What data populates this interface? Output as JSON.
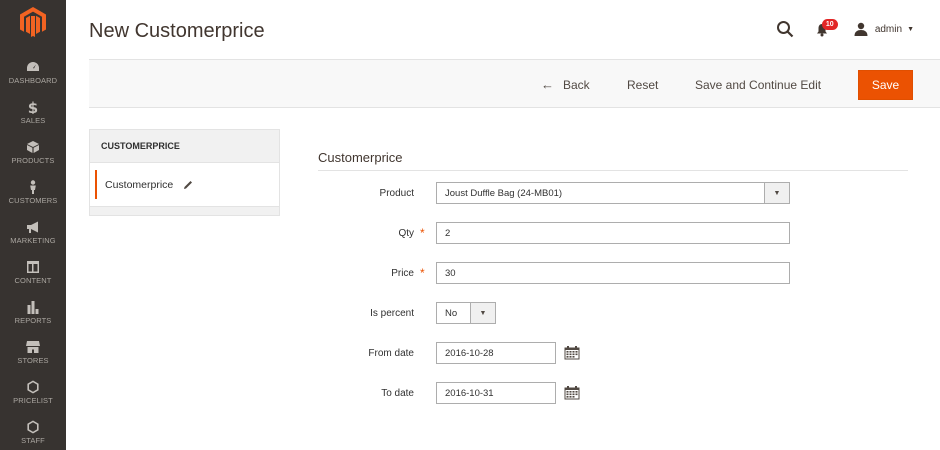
{
  "nav": {
    "items": [
      {
        "label": "DASHBOARD",
        "icon": "dashboard-icon"
      },
      {
        "label": "SALES",
        "icon": "dollar-icon"
      },
      {
        "label": "PRODUCTS",
        "icon": "cube-icon"
      },
      {
        "label": "CUSTOMERS",
        "icon": "person-icon"
      },
      {
        "label": "MARKETING",
        "icon": "megaphone-icon"
      },
      {
        "label": "CONTENT",
        "icon": "layout-icon"
      },
      {
        "label": "REPORTS",
        "icon": "bar-chart-icon"
      },
      {
        "label": "STORES",
        "icon": "storefront-icon"
      },
      {
        "label": "PRICELIST",
        "icon": "hexagon-icon"
      },
      {
        "label": "STAFF",
        "icon": "hexagon-icon"
      }
    ]
  },
  "header": {
    "title": "New Customerprice",
    "notifications_count": "10",
    "user_name": "admin"
  },
  "actions": {
    "back_label": "Back",
    "reset_label": "Reset",
    "save_continue_label": "Save and Continue Edit",
    "save_label": "Save"
  },
  "tabs": {
    "title": "CUSTOMERPRICE",
    "items": [
      {
        "label": "Customerprice"
      }
    ]
  },
  "form": {
    "section_title": "Customerprice",
    "fields": {
      "product": {
        "label": "Product",
        "value": "Joust Duffle Bag (24-MB01)"
      },
      "qty": {
        "label": "Qty",
        "value": "2",
        "required_mark": "*"
      },
      "price": {
        "label": "Price",
        "value": "30",
        "required_mark": "*"
      },
      "is_percent": {
        "label": "Is percent",
        "value": "No"
      },
      "from_date": {
        "label": "From date",
        "value": "2016-10-28"
      },
      "to_date": {
        "label": "To date",
        "value": "2016-10-31"
      }
    }
  },
  "colors": {
    "sidebar_bg": "#373330",
    "accent": "#eb5202",
    "logo": "#f26322"
  }
}
